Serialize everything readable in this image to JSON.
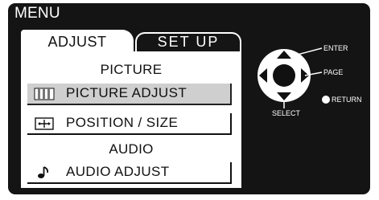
{
  "window": {
    "title": "MENU"
  },
  "tabs": [
    {
      "label": "ADJUST",
      "active": true
    },
    {
      "label": "SET UP",
      "active": false
    }
  ],
  "panel": {
    "picture_heading": "PICTURE",
    "audio_heading": "AUDIO",
    "items": [
      {
        "label": "PICTURE  ADJUST",
        "icon": "picture-bars-icon",
        "selected": true
      },
      {
        "label": "POSITION / SIZE",
        "icon": "position-arrows-icon",
        "selected": false
      },
      {
        "label": "AUDIO  ADJUST",
        "icon": "music-note-icon",
        "selected": false
      }
    ]
  },
  "remote_legend": {
    "enter": "ENTER",
    "page": "PAGE",
    "select": "SELECT",
    "return": "RETURN"
  },
  "colors": {
    "background": "#141414",
    "panel": "#ffffff",
    "selected_row": "#cfcfcf",
    "text_light": "#ffffff",
    "text_dark": "#111111"
  }
}
